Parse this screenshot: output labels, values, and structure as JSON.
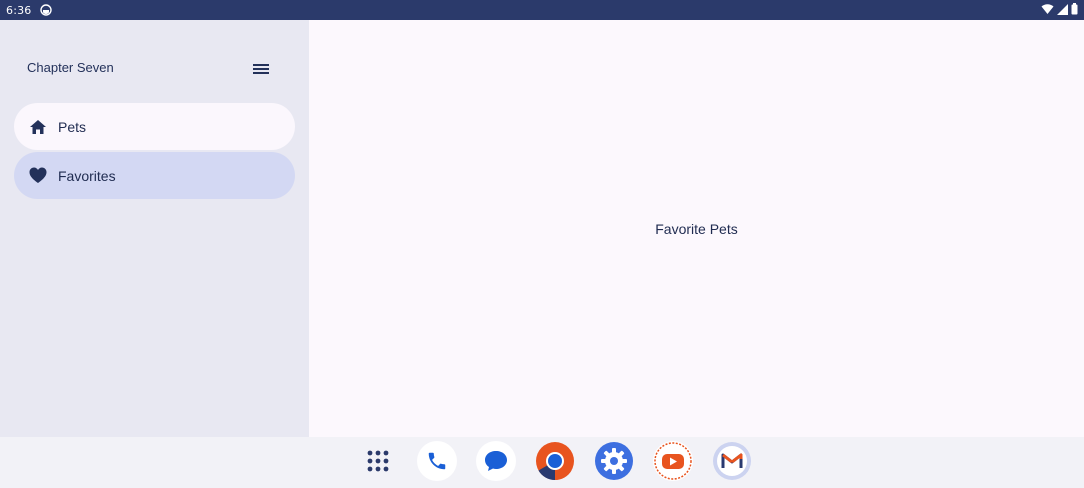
{
  "status_bar": {
    "time": "6:36",
    "app_icon": "notification-app-icon",
    "right_icons": [
      "wifi-icon",
      "signal-icon",
      "battery-icon"
    ]
  },
  "drawer": {
    "title": "Chapter Seven",
    "menu_icon": "menu-icon",
    "items": [
      {
        "label": "Pets",
        "icon": "home-icon",
        "selected": false
      },
      {
        "label": "Favorites",
        "icon": "heart-icon",
        "selected": true
      }
    ]
  },
  "main": {
    "title": "Favorite Pets"
  },
  "dock": {
    "apps": [
      {
        "name": "app-drawer",
        "icon": "apps-grid-icon"
      },
      {
        "name": "phone",
        "icon": "phone-icon"
      },
      {
        "name": "messages",
        "icon": "messages-icon"
      },
      {
        "name": "chrome",
        "icon": "chrome-icon"
      },
      {
        "name": "settings",
        "icon": "settings-icon"
      },
      {
        "name": "youtube",
        "icon": "youtube-icon"
      },
      {
        "name": "gmail",
        "icon": "gmail-icon"
      }
    ]
  },
  "colors": {
    "status_bar": "#2b3a6b",
    "drawer_bg": "#e8e8f2",
    "selected_item_bg": "#d3d8f3",
    "text_primary": "#1f2b50"
  }
}
